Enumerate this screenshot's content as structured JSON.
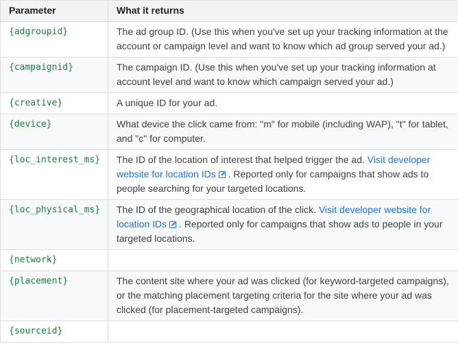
{
  "header": {
    "param_col": "Parameter",
    "return_col": "What it returns"
  },
  "rows": [
    {
      "param": "{adgroupid}",
      "desc": "The ad group ID. (Use this when you've set up your tracking information at the account or campaign level and want to know which ad group served your ad.)"
    },
    {
      "param": "{campaignid}",
      "desc": "The campaign ID. (Use this when you've set up your tracking information at account level and want to know which campaign served your ad.)"
    },
    {
      "param": "{creative}",
      "desc": "A unique ID for your ad."
    },
    {
      "param": "{device}",
      "desc": "What device the click came from: \"m\" for mobile (including WAP), \"t\" for tablet, and \"c\" for computer."
    },
    {
      "param": "{loc_interest_ms}",
      "desc_before": "The ID of the location of interest that helped trigger the ad.",
      "link": "Visit developer website for location IDs",
      "desc_after": ". Reported only for campaigns that show ads to people searching for your targeted locations."
    },
    {
      "param": "{loc_physical_ms}",
      "desc_before": "The ID of the geographical location of the click.",
      "link": "Visit developer website for location IDs",
      "desc_after": ". Reported only for campaigns that show ads to people in your targeted locations."
    },
    {
      "param": "{network}",
      "desc": ""
    },
    {
      "param": "{placement}",
      "desc": "The content site where your ad was clicked (for keyword-targeted campaigns), or the matching placement targeting criteria for the site where your ad was clicked (for placement-targeted campaigns)."
    },
    {
      "param": "{sourceid}",
      "desc": ""
    }
  ]
}
